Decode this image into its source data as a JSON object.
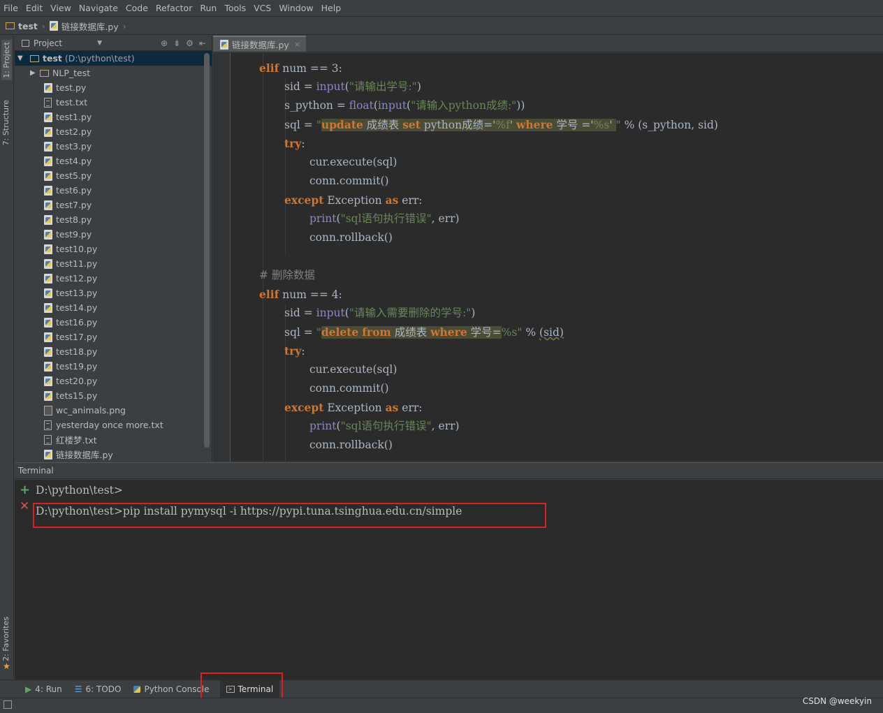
{
  "menu": [
    "File",
    "Edit",
    "View",
    "Navigate",
    "Code",
    "Refactor",
    "Run",
    "Tools",
    "VCS",
    "Window",
    "Help"
  ],
  "breadcrumb": {
    "project": "test",
    "file": "链接数据库.py"
  },
  "left_strip": {
    "project_tab": "1: Project",
    "structure_tab": "7: Structure",
    "favorites_tab": "2: Favorites"
  },
  "project_panel": {
    "title": "Project",
    "root": {
      "name": "test",
      "path": "(D:\\python\\test)"
    },
    "items": [
      {
        "name": "NLP_test",
        "type": "folder"
      },
      {
        "name": "test.py",
        "type": "py"
      },
      {
        "name": "test.txt",
        "type": "txt"
      },
      {
        "name": "test1.py",
        "type": "py"
      },
      {
        "name": "test2.py",
        "type": "py"
      },
      {
        "name": "test3.py",
        "type": "py"
      },
      {
        "name": "test4.py",
        "type": "py"
      },
      {
        "name": "test5.py",
        "type": "py"
      },
      {
        "name": "test6.py",
        "type": "py"
      },
      {
        "name": "test7.py",
        "type": "py"
      },
      {
        "name": "test8.py",
        "type": "py"
      },
      {
        "name": "test9.py",
        "type": "py"
      },
      {
        "name": "test10.py",
        "type": "py"
      },
      {
        "name": "test11.py",
        "type": "py"
      },
      {
        "name": "test12.py",
        "type": "py"
      },
      {
        "name": "test13.py",
        "type": "py"
      },
      {
        "name": "test14.py",
        "type": "py"
      },
      {
        "name": "test16.py",
        "type": "py"
      },
      {
        "name": "test17.py",
        "type": "py"
      },
      {
        "name": "test18.py",
        "type": "py"
      },
      {
        "name": "test19.py",
        "type": "py"
      },
      {
        "name": "test20.py",
        "type": "py"
      },
      {
        "name": "tets15.py",
        "type": "py"
      },
      {
        "name": "wc_animals.png",
        "type": "img"
      },
      {
        "name": "yesterday once more.txt",
        "type": "txt"
      },
      {
        "name": "红楼梦.txt",
        "type": "txt"
      },
      {
        "name": "链接数据库.py",
        "type": "py"
      }
    ]
  },
  "editor": {
    "tab_label": "链接数据库.py",
    "code": {
      "l1_kw": "elif",
      "l1_rest": " num == 3:",
      "l2_a": "sid = ",
      "l2_fn": "input",
      "l2_b": "(",
      "l2_str": "\"请输出学号:\"",
      "l2_c": ")",
      "l3_a": "s_python = ",
      "l3_fn": "float",
      "l3_b": "(",
      "l3_fn2": "input",
      "l3_c": "(",
      "l3_str": "\"请输入python成绩:\"",
      "l3_d": "))",
      "l4_a": "sql = ",
      "l4_q": "\"",
      "l4_k1": "update",
      "l4_t1": " 成绩表 ",
      "l4_k2": "set",
      "l4_t2": " python成绩='",
      "l4_s1": "%f",
      "l4_t3": "' ",
      "l4_k3": "where",
      "l4_t4": " 学号 ='",
      "l4_s2": "%s",
      "l4_t5": "' ",
      "l4_q2": "\"",
      "l4_rest": " % (s_python, sid)",
      "l5_kw": "try",
      "l5_rest": ":",
      "l6": "cur.execute(sql)",
      "l7": "conn.commit()",
      "l8_kw": "except",
      "l8_a": " Exception ",
      "l8_kw2": "as",
      "l8_b": " err:",
      "l9_fn": "print",
      "l9_a": "(",
      "l9_str": "\"sql语句执行错误\"",
      "l9_b": ", err)",
      "l10": "conn.rollback()",
      "l12": "# 删除数据",
      "l13_kw": "elif",
      "l13_rest": " num == 4:",
      "l14_a": "sid = ",
      "l14_fn": "input",
      "l14_b": "(",
      "l14_str": "\"请输入需要删除的学号:\"",
      "l14_c": ")",
      "l15_a": "sql = ",
      "l15_q": "\"",
      "l15_k1": "delete",
      "l15_sp": " ",
      "l15_k2": "from",
      "l15_t1": " 成绩表 ",
      "l15_k3": "where",
      "l15_t2": " 学号=",
      "l15_s1": "%s",
      "l15_q2": "\"",
      "l15_rest": " % ",
      "l15_u": "(sid)",
      "l16_kw": "try",
      "l16_rest": ":",
      "l17": "cur.execute(sql)",
      "l18": "conn.commit()",
      "l19_kw": "except",
      "l19_a": " Exception ",
      "l19_kw2": "as",
      "l19_b": " err:",
      "l20_fn": "print",
      "l20_a": "(",
      "l20_str": "\"sql语句执行错误\"",
      "l20_b": ", err)",
      "l21": "conn.rollback()"
    }
  },
  "terminal": {
    "title": "Terminal",
    "line1": "D:\\python\\test>",
    "line2": "D:\\python\\test>pip install pymysql -i https://pypi.tuna.tsinghua.edu.cn/simple"
  },
  "bottom_tabs": [
    {
      "label": "4: Run",
      "icon": "run-icon"
    },
    {
      "label": "6: TODO",
      "icon": "todo-icon"
    },
    {
      "label": "Python Console",
      "icon": "python-console-icon"
    },
    {
      "label": "Terminal",
      "icon": "terminal-icon"
    }
  ],
  "watermark": "CSDN @weekyin",
  "colors": {
    "keyword": "#cc7832",
    "string": "#6a8759",
    "builtin": "#8888c6",
    "highlight": "#4b4b36",
    "annotation_box": "#e02020"
  }
}
